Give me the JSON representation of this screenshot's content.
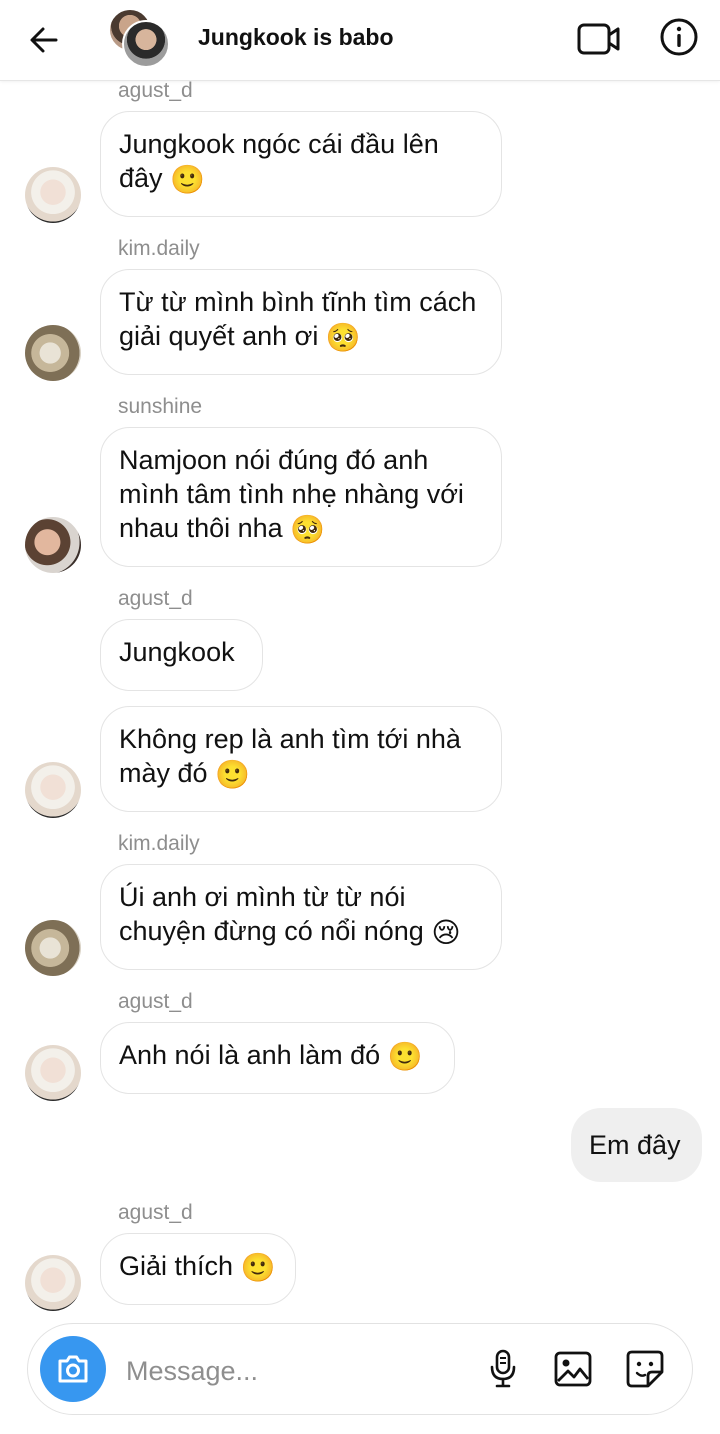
{
  "header": {
    "title": "Jungkook is babo",
    "icons": {
      "back": "back-arrow-icon",
      "video": "video-call-icon",
      "info": "info-icon"
    }
  },
  "messages": [
    {
      "sender": "agust_d",
      "text": "Jungkook ngóc cái đầu lên đây",
      "emoji": "🙂"
    },
    {
      "sender": "kim.daily",
      "text": "Từ từ mình bình tĩnh tìm cách giải quyết anh ơi",
      "emoji": "🥺"
    },
    {
      "sender": "sunshine",
      "text": "Namjoon nói đúng đó anh mình tâm tình nhẹ nhàng với nhau thôi nha",
      "emoji": "🥺"
    },
    {
      "sender": "agust_d",
      "text": "Jungkook"
    },
    {
      "text": "Không rep là anh tìm tới nhà mày đó",
      "emoji": "🙂"
    },
    {
      "sender": "kim.daily",
      "text": "Úi anh ơi mình từ từ nói chuyện đừng có nổi nóng",
      "emoji": "😢"
    },
    {
      "sender": "agust_d",
      "text": "Anh nói là anh làm đó",
      "emoji": "🙂"
    },
    {
      "text": "Em đây",
      "mine": true
    },
    {
      "sender": "agust_d",
      "text": "Giải thích",
      "emoji": "🙂"
    }
  ],
  "composer": {
    "placeholder": "Message...",
    "accent": "#3797f0",
    "icons": {
      "camera": "camera-icon",
      "mic": "microphone-icon",
      "gallery": "gallery-icon",
      "sticker": "sticker-icon"
    }
  }
}
